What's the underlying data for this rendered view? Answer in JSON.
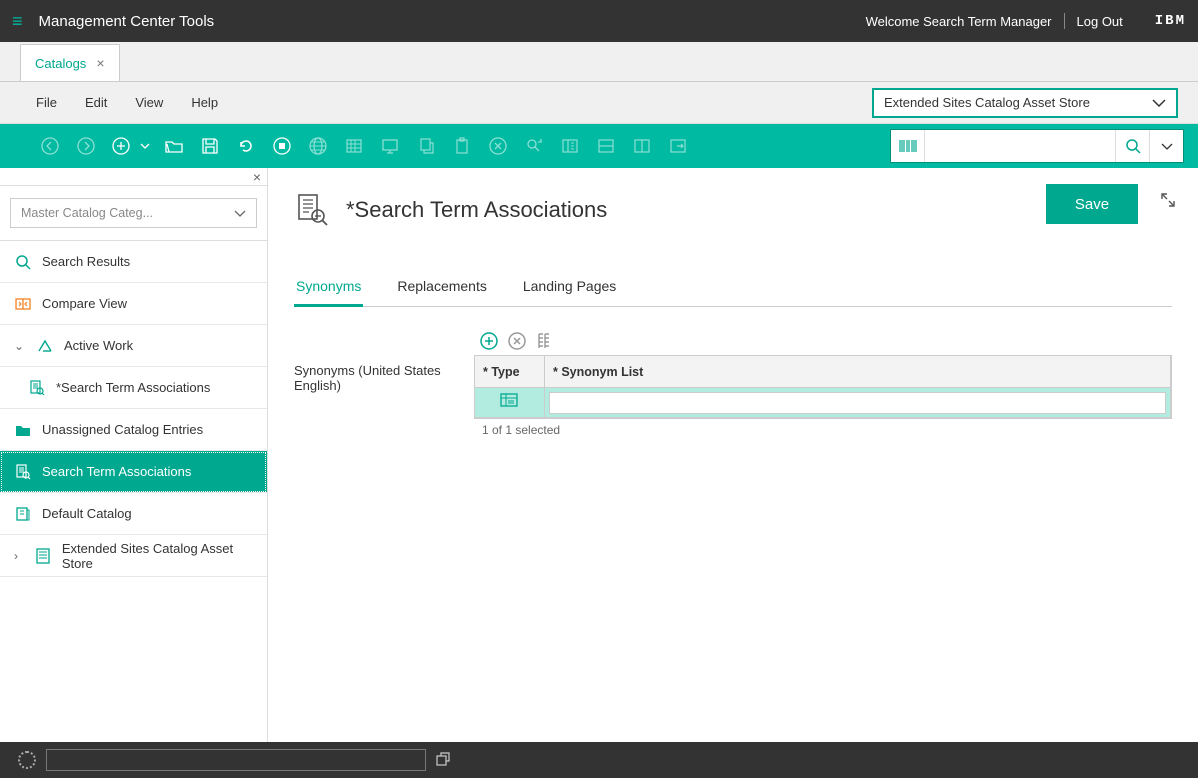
{
  "topbar": {
    "title": "Management Center Tools",
    "welcome": "Welcome Search Term Manager",
    "logout": "Log Out",
    "logo": "IBM"
  },
  "tabstrip": {
    "tab1": "Catalogs"
  },
  "menubar": {
    "file": "File",
    "edit": "Edit",
    "view": "View",
    "help": "Help",
    "store": "Extended Sites Catalog Asset Store"
  },
  "sidebar": {
    "dropdown": "Master Catalog Categ...",
    "search_results": "Search Results",
    "compare_view": "Compare View",
    "active_work": "Active Work",
    "sta_child": "*Search Term Associations",
    "unassigned": "Unassigned Catalog Entries",
    "sta_sel": "Search Term Associations",
    "default_catalog": "Default Catalog",
    "ext_store": "Extended Sites Catalog Asset Store"
  },
  "main": {
    "title": "*Search Term Associations",
    "save": "Save",
    "tabs": {
      "synonyms": "Synonyms",
      "replacements": "Replacements",
      "landing": "Landing Pages"
    },
    "synonyms_label": "Synonyms (United States English)",
    "col_type": "* Type",
    "col_list": "* Synonym List",
    "footer": "1 of 1 selected"
  }
}
